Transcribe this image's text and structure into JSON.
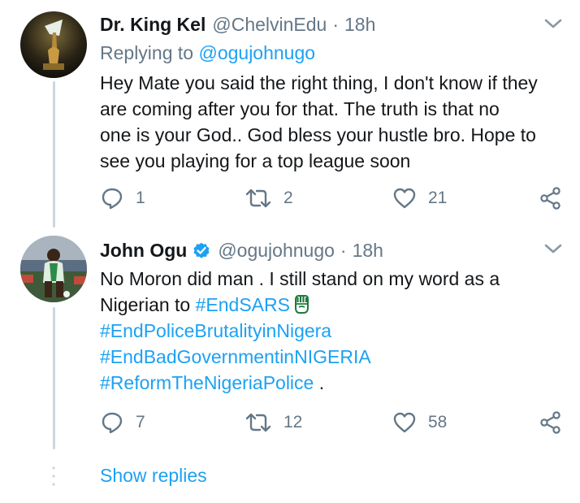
{
  "tweets": [
    {
      "name": "Dr. King Kel",
      "handle": "@ChelvinEdu",
      "time": "18h",
      "replying_label": "Replying to",
      "replying_to": "@ogujohnugo",
      "lines": [
        "Hey Mate you said the right thing, I don't know if they",
        "are coming after you for that. The truth is that no",
        "one is your God.. God bless your hustle bro. Hope to",
        "see you playing for a top league soon"
      ],
      "replies": "1",
      "retweets": "2",
      "likes": "21"
    },
    {
      "name": "John Ogu",
      "handle": "@ogujohnugo",
      "time": "18h",
      "verified": true,
      "line1": "No Moron did man . I still stand on my word as a",
      "line2_prefix": "Nigerian to ",
      "hashtag1": "#EndSARS",
      "hashtag2": "#EndPoliceBrutalityinNigera",
      "hashtag3": "#EndBadGovernmentinNIGERIA",
      "hashtag4": "#ReformTheNigeriaPolice",
      "line5_suffix": " .",
      "replies": "7",
      "retweets": "12",
      "likes": "58"
    }
  ],
  "separator_dot": "·",
  "show_replies": "Show replies",
  "colors": {
    "link": "#1da1f2",
    "secondary": "#657786",
    "text": "#14171a",
    "thread_line": "#ccd6dd"
  },
  "icons": [
    "chevron-down-icon",
    "reply-icon",
    "retweet-icon",
    "like-icon",
    "share-icon",
    "verified-icon",
    "raised-fist-emoji"
  ]
}
